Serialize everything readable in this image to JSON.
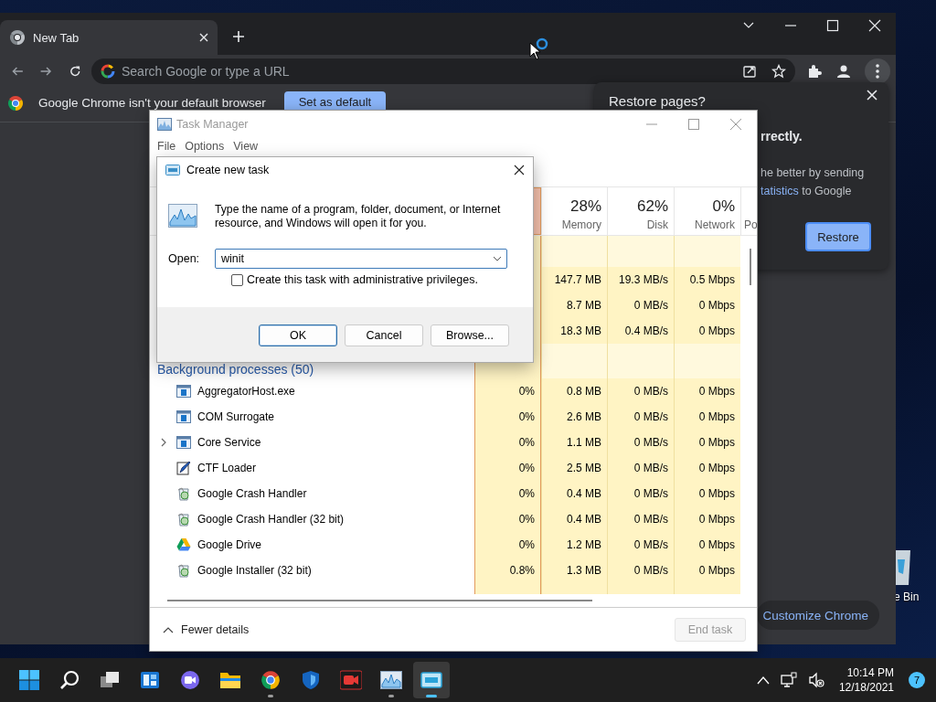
{
  "chrome": {
    "tabs": [
      {
        "label": "New Tab",
        "selected": true
      }
    ],
    "omnibox": {
      "placeholder": "Search Google or type a URL"
    },
    "infobar": {
      "message": "Google Chrome isn't your default browser",
      "button": "Set as default"
    },
    "restore_popup": {
      "title": "Restore pages?",
      "heading_fragment": "rrectly.",
      "paragraph": {
        "line_1": "he better by sending",
        "link": "tatistics",
        "after_link": " to Google"
      },
      "button": "Restore"
    },
    "customize_button": "Customize Chrome"
  },
  "desktop": {
    "icon_label": "e Bin"
  },
  "task_manager": {
    "title": "Task Manager",
    "menu": [
      "File",
      "Options",
      "View"
    ],
    "columns": [
      {
        "percent": "28%",
        "label": "Memory"
      },
      {
        "percent": "62%",
        "label": "Disk"
      },
      {
        "percent": "0%",
        "label": "Network"
      },
      {
        "label": "Po"
      }
    ],
    "app_rows": [
      {
        "memory": "147.7 MB",
        "disk": "19.3 MB/s",
        "network": "0.5 Mbps"
      },
      {
        "memory": "8.7 MB",
        "disk": "0 MB/s",
        "network": "0 Mbps"
      },
      {
        "memory": "18.3 MB",
        "disk": "0.4 MB/s",
        "network": "0 Mbps"
      }
    ],
    "group": "Background processes (50)",
    "rows": [
      {
        "name": "AggregatorHost.exe",
        "kind": "service",
        "expandable": false,
        "cpu": "0%",
        "memory": "0.8 MB",
        "disk": "0 MB/s",
        "network": "0 Mbps"
      },
      {
        "name": "COM Surrogate",
        "kind": "service",
        "expandable": false,
        "cpu": "0%",
        "memory": "2.6 MB",
        "disk": "0 MB/s",
        "network": "0 Mbps"
      },
      {
        "name": "Core Service",
        "kind": "service",
        "expandable": true,
        "cpu": "0%",
        "memory": "1.1 MB",
        "disk": "0 MB/s",
        "network": "0 Mbps"
      },
      {
        "name": "CTF Loader",
        "kind": "pen",
        "expandable": false,
        "cpu": "0%",
        "memory": "2.5 MB",
        "disk": "0 MB/s",
        "network": "0 Mbps"
      },
      {
        "name": "Google Crash Handler",
        "kind": "installer",
        "expandable": false,
        "cpu": "0%",
        "memory": "0.4 MB",
        "disk": "0 MB/s",
        "network": "0 Mbps"
      },
      {
        "name": "Google Crash Handler (32 bit)",
        "kind": "installer",
        "expandable": false,
        "cpu": "0%",
        "memory": "0.4 MB",
        "disk": "0 MB/s",
        "network": "0 Mbps"
      },
      {
        "name": "Google Drive",
        "kind": "drive",
        "expandable": false,
        "cpu": "0%",
        "memory": "1.2 MB",
        "disk": "0 MB/s",
        "network": "0 Mbps"
      },
      {
        "name": "Google Installer (32 bit)",
        "kind": "installer",
        "expandable": false,
        "cpu": "0.8%",
        "memory": "1.3 MB",
        "disk": "0 MB/s",
        "network": "0 Mbps"
      }
    ],
    "footer": {
      "toggle": "Fewer details",
      "end_task": {
        "label": "End task",
        "disabled": true
      }
    }
  },
  "dialog": {
    "title": "Create new task",
    "description": "Type the name of a program, folder, document, or Internet resource, and Windows will open it for you.",
    "open_label": "Open:",
    "value": "winit",
    "checkbox": {
      "label": "Create this task with administrative privileges.",
      "checked": false
    },
    "buttons": [
      {
        "label": "OK",
        "default": true
      },
      {
        "label": "Cancel",
        "default": false
      },
      {
        "label": "Browse...",
        "default": false
      }
    ]
  },
  "taskbar": {
    "apps": [
      {
        "kind": "start",
        "running": false,
        "active": false
      },
      {
        "kind": "search",
        "running": false,
        "active": false
      },
      {
        "kind": "task-view",
        "running": false,
        "active": false
      },
      {
        "kind": "widgets",
        "running": false,
        "active": false
      },
      {
        "kind": "chat",
        "running": false,
        "active": false
      },
      {
        "kind": "explorer",
        "running": false,
        "active": false
      },
      {
        "kind": "chrome",
        "running": true,
        "active": false
      },
      {
        "kind": "shield",
        "running": false,
        "active": false
      },
      {
        "kind": "camera",
        "running": false,
        "active": false
      },
      {
        "kind": "task-manager",
        "running": true,
        "active": false
      },
      {
        "kind": "run",
        "running": true,
        "active": true
      }
    ],
    "clock": {
      "time": "10:14 PM",
      "date": "12/18/2021"
    },
    "notification_count": "7"
  }
}
